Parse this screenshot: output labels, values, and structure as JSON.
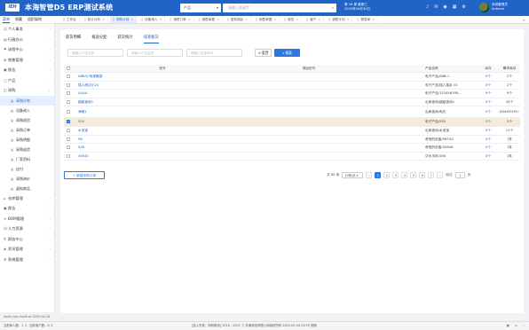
{
  "header": {
    "logo": "IEH",
    "title": "本海智管D5 ERP测试系统",
    "search_category": "产品",
    "search_placeholder": "请输入关键字",
    "date_line1": "第 16 周 星期三",
    "date_line2": "2025年04月30日",
    "user_line1": "系统管理员",
    "user_line2": "Anthem"
  },
  "sub_tabs": [
    "菜单",
    "收藏",
    "组织架构"
  ],
  "sidebar": {
    "items": [
      {
        "label": "个人事务",
        "icon": "person"
      },
      {
        "label": "行政办公",
        "icon": "doc"
      },
      {
        "label": "流程中心",
        "icon": "flow"
      },
      {
        "label": "销售管理",
        "icon": "cart"
      },
      {
        "label": "报告",
        "icon": "chart"
      },
      {
        "label": "产品",
        "icon": "box"
      },
      {
        "label": "采购",
        "icon": "bag"
      }
    ],
    "sub_items": [
      "采购计划",
      "设备询入",
      "采购退货",
      "采购订单",
      "采购明细",
      "采购退货",
      "厂家资料",
      "应付",
      "采购询价",
      "虚拟商品"
    ],
    "bottom_items": [
      "仓库管理",
      "报告",
      "BOM管理",
      "人力资源",
      "财务中心",
      "资讯管理",
      "系统管理"
    ],
    "footer": "ilanhi.com build at 2025-04-28"
  },
  "tabs": [
    "工作台",
    "统计分析",
    "采购计划",
    "设备询入",
    "销售订单",
    "销售单据",
    "虚拟商品",
    "销售单据",
    "报告",
    "客户",
    "销售计划",
    "报表单"
  ],
  "inner_tabs": [
    "获货明细",
    "报送分配",
    "获货统计",
    "排查备货"
  ],
  "filters": {
    "type_placeholder": "请输入产品名称",
    "name_placeholder": "请输入产品名称",
    "source_placeholder": "请输入来源单号",
    "reset": "重置",
    "search": "搜索"
  },
  "table": {
    "headers": {
      "type": "型号",
      "source": "源始型号",
      "name": "产品名称",
      "stock": "库存",
      "lib": "需求库存"
    },
    "rows": [
      {
        "type": "ABB/小电源器部",
        "source": "",
        "name": "电子产品/ABB-1",
        "stock": "0个",
        "lib": "2个",
        "checked": false
      },
      {
        "type": "插入底边小20",
        "source": "",
        "name": "电子产品/插入接卦-01",
        "stock": "0个",
        "lib": "2个",
        "checked": false
      },
      {
        "type": "AAAA",
        "source": "",
        "name": "电子产品/123456789...",
        "stock": "9个",
        "lib": "9个",
        "checked": false
      },
      {
        "type": "超级查询1",
        "source": "",
        "name": "出库查询/超级查询1",
        "stock": "0个",
        "lib": "34个",
        "checked": false
      },
      {
        "type": "海哩1",
        "source": "",
        "name": "出库查询/电光",
        "stock": "0个",
        "lib": "4294967295个",
        "checked": false
      },
      {
        "type": "555",
        "source": "",
        "name": "电子产品/555",
        "stock": "0个",
        "lib": "5个",
        "checked": true
      },
      {
        "type": "水泥宝",
        "source": "",
        "name": "出库查询/水泥宝",
        "stock": "0个",
        "lib": "11个",
        "checked": false
      },
      {
        "type": "56",
        "source": "",
        "name": "奇怪的设备/5675G",
        "stock": "0个",
        "lib": "1件",
        "checked": false
      },
      {
        "type": "546",
        "source": "",
        "name": "奇怪的设备/45646",
        "stock": "0个",
        "lib": "1件",
        "checked": false
      },
      {
        "type": "45645",
        "source": "",
        "name": "华为手机/456",
        "stock": "0个",
        "lib": "1件",
        "checked": false
      }
    ]
  },
  "add_button": "+ 新建采购订单",
  "pager": {
    "total": "共 68 条",
    "size": "10条/页",
    "pages": [
      "1",
      "2",
      "3",
      "4",
      "5",
      "6",
      "7"
    ],
    "prev": "‹",
    "next": "›",
    "goto_label": "前往",
    "goto_value": "1",
    "page_unit": "页"
  },
  "statusbar": {
    "left1": "当前库人数：1 人",
    "left2": "当前用户数：6 人",
    "mid": "[加入失效，商码用码] 2016 - 2022 ⓒ 本海科技有限公司版权所有 2025-05-04 23:59 到期",
    "right_icons": [
      "qr",
      "monitor",
      "chat"
    ]
  }
}
